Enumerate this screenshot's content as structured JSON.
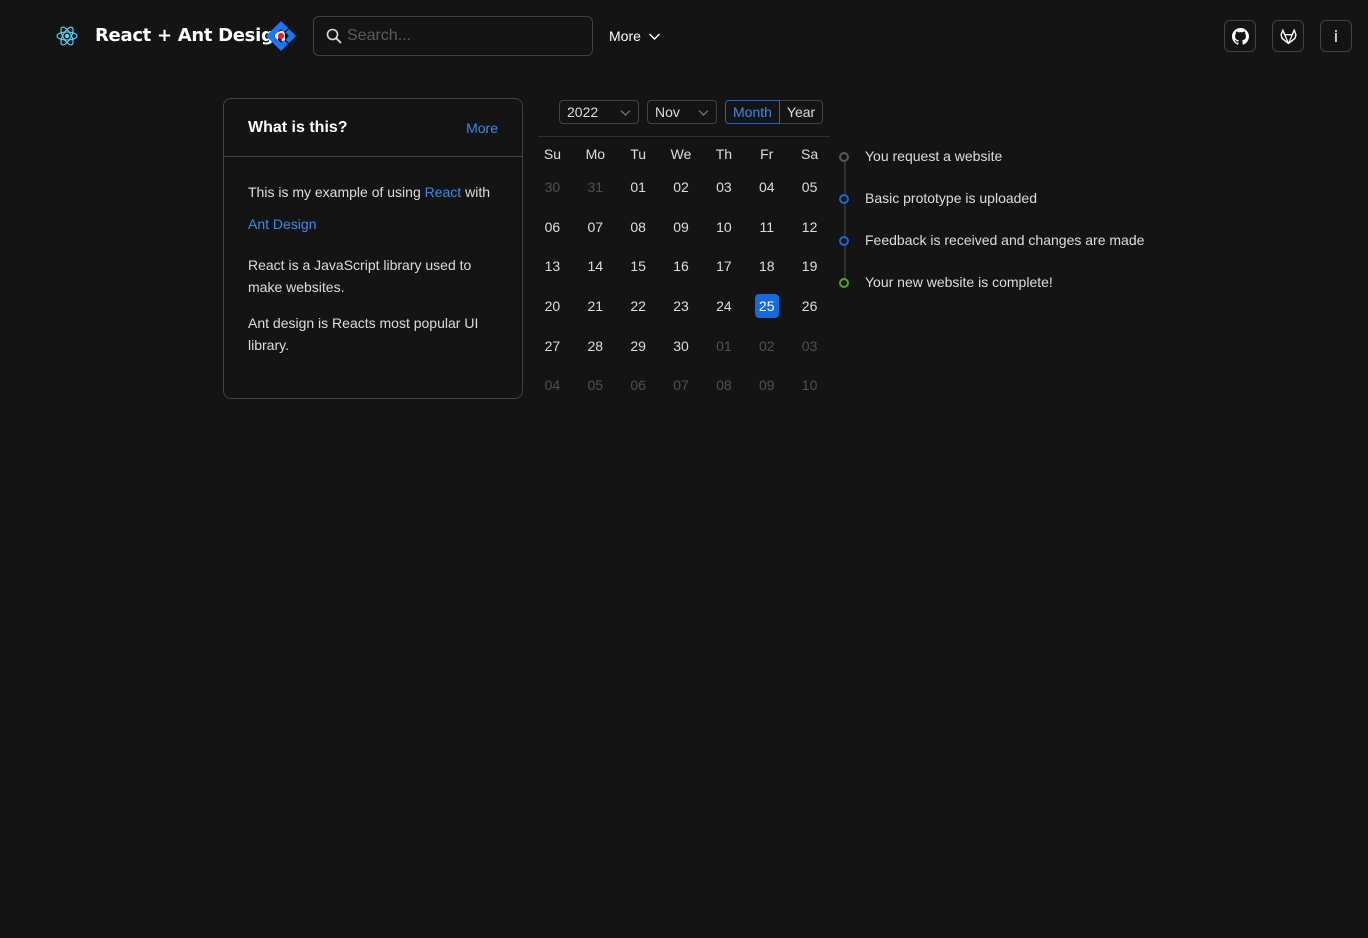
{
  "header": {
    "brand": "React + Ant Design",
    "search_placeholder": "Search...",
    "more_label": "More"
  },
  "card": {
    "title": "What is this?",
    "more_label": "More",
    "intro_prefix": "This is my example of using",
    "react_link": "React",
    "intro_mid": "with",
    "antd_link": "Ant Design",
    "para2": "React is a JavaScript library used to make websites.",
    "para3": "Ant design is Reacts most popular UI library."
  },
  "calendar": {
    "year": "2022",
    "month": "Nov",
    "mode_month": "Month",
    "mode_year": "Year",
    "weekdays": [
      "Su",
      "Mo",
      "Tu",
      "We",
      "Th",
      "Fr",
      "Sa"
    ],
    "selected": "25",
    "weeks": [
      [
        {
          "d": "30",
          "out": true
        },
        {
          "d": "31",
          "out": true
        },
        {
          "d": "01"
        },
        {
          "d": "02"
        },
        {
          "d": "03"
        },
        {
          "d": "04"
        },
        {
          "d": "05"
        }
      ],
      [
        {
          "d": "06"
        },
        {
          "d": "07"
        },
        {
          "d": "08"
        },
        {
          "d": "09"
        },
        {
          "d": "10"
        },
        {
          "d": "11"
        },
        {
          "d": "12"
        }
      ],
      [
        {
          "d": "13"
        },
        {
          "d": "14"
        },
        {
          "d": "15"
        },
        {
          "d": "16"
        },
        {
          "d": "17"
        },
        {
          "d": "18"
        },
        {
          "d": "19"
        }
      ],
      [
        {
          "d": "20"
        },
        {
          "d": "21"
        },
        {
          "d": "22"
        },
        {
          "d": "23"
        },
        {
          "d": "24"
        },
        {
          "d": "25"
        },
        {
          "d": "26"
        }
      ],
      [
        {
          "d": "27"
        },
        {
          "d": "28"
        },
        {
          "d": "29"
        },
        {
          "d": "30"
        },
        {
          "d": "01",
          "out": true
        },
        {
          "d": "02",
          "out": true
        },
        {
          "d": "03",
          "out": true
        }
      ],
      [
        {
          "d": "04",
          "out": true
        },
        {
          "d": "05",
          "out": true
        },
        {
          "d": "06",
          "out": true
        },
        {
          "d": "07",
          "out": true
        },
        {
          "d": "08",
          "out": true
        },
        {
          "d": "09",
          "out": true
        },
        {
          "d": "10",
          "out": true
        }
      ]
    ]
  },
  "timeline": [
    {
      "text": "You request a website",
      "color": "#595959"
    },
    {
      "text": "Basic prototype is uploaded",
      "color": "#1668dc"
    },
    {
      "text": "Feedback is received and changes are made",
      "color": "#1668dc"
    },
    {
      "text": "Your new website is complete!",
      "color": "#49aa19"
    }
  ],
  "colors": {
    "background": "#141414",
    "primary": "#1668dc",
    "link": "#3c89e8",
    "border": "#424242"
  },
  "icons": [
    "react-icon",
    "ant-design-icon",
    "search-icon",
    "chevron-down-icon",
    "github-icon",
    "gitlab-icon",
    "info-icon"
  ]
}
